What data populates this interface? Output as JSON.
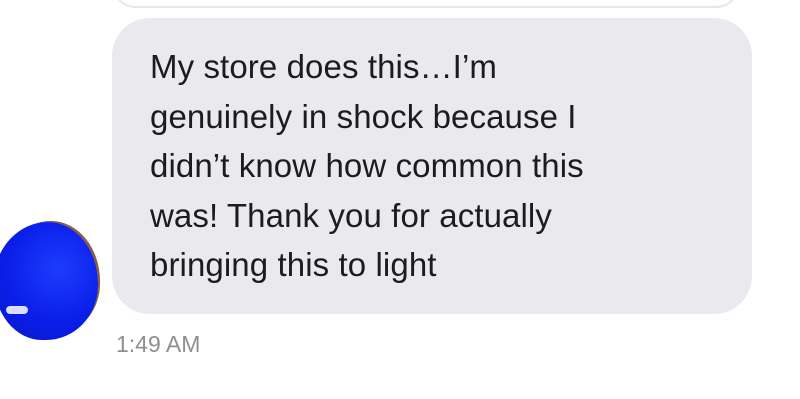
{
  "conversation": {
    "message": {
      "text": "My store does this…I’m\ngenuinely in shock because I\ndidn’t know how common this\nwas! Thank you for actually\nbringing this to light",
      "timestamp": "1:49 AM"
    },
    "avatar": {
      "description_color": "#0a1ee8"
    }
  },
  "colors": {
    "bubble_background": "#e9e9ee",
    "text": "#1c1c1e",
    "timestamp": "#8e8e93",
    "page_background": "#ffffff"
  }
}
